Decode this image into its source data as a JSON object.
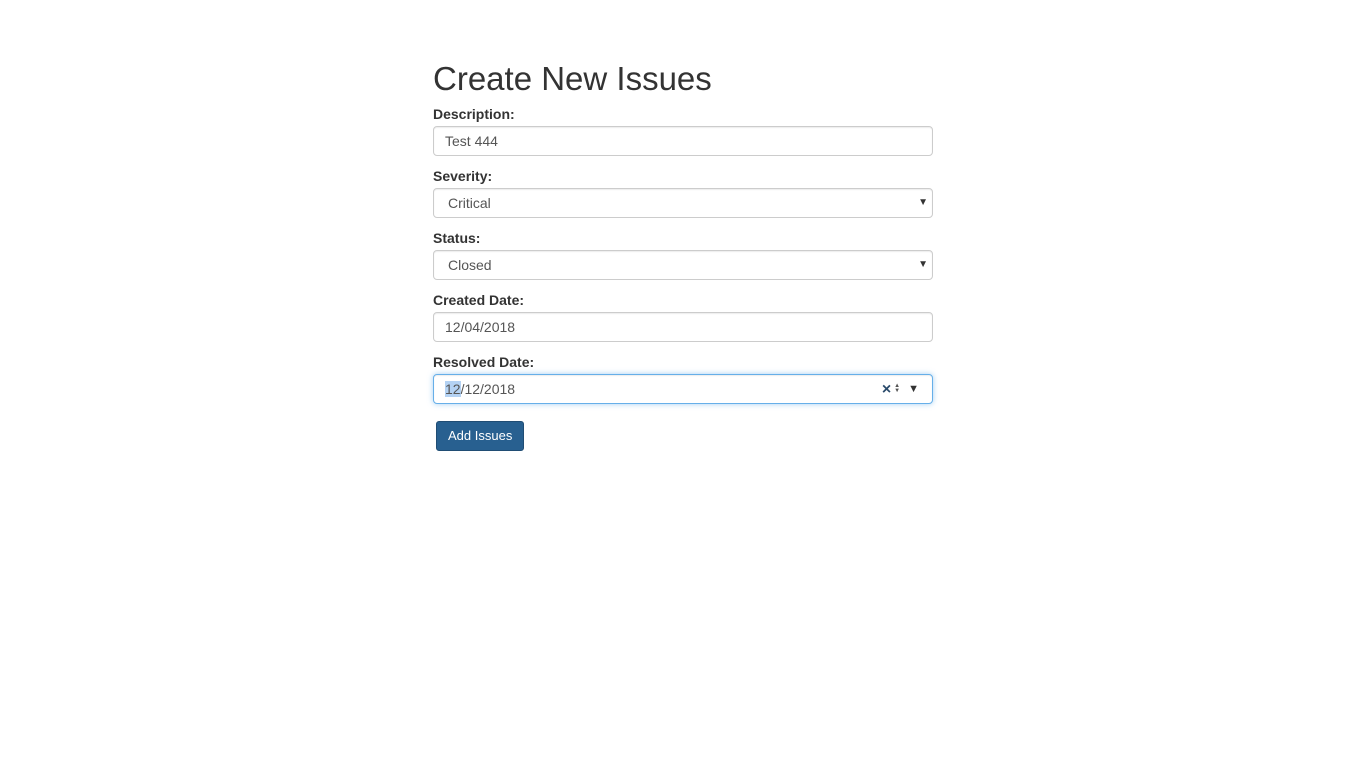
{
  "form": {
    "title": "Create New Issues",
    "description": {
      "label": "Description:",
      "value": "Test 444"
    },
    "severity": {
      "label": "Severity:",
      "value": "Critical"
    },
    "status": {
      "label": "Status:",
      "value": "Closed"
    },
    "created_date": {
      "label": "Created Date:",
      "value": "12/04/2018"
    },
    "resolved_date": {
      "label": "Resolved Date:",
      "value_selected_part": "12",
      "value_rest": "/12/2018"
    },
    "submit_label": "Add Issues"
  },
  "icons": {
    "clear": "×",
    "spinner_up": "▲",
    "spinner_down": "▼",
    "dropdown": "▼",
    "select_caret": "▼"
  },
  "colors": {
    "button_bg": "#286090",
    "focus_border": "#66afe9",
    "selection": "#b4d2f3"
  }
}
